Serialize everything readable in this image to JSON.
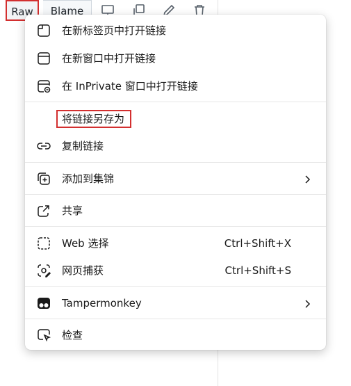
{
  "toolbar": {
    "raw_label": "Raw",
    "blame_label": "Blame",
    "icons": [
      "display-icon",
      "copy-icon",
      "pencil-icon",
      "trash-icon"
    ]
  },
  "menu": {
    "open_new_tab": "在新标签页中打开链接",
    "open_new_window": "在新窗口中打开链接",
    "open_inprivate": "在 InPrivate 窗口中打开链接",
    "save_link_as": "将链接另存为",
    "copy_link": "复制链接",
    "add_to_collections": "添加到集锦",
    "share": "共享",
    "web_select": "Web 选择",
    "web_select_shortcut": "Ctrl+Shift+X",
    "web_capture": "网页捕获",
    "web_capture_shortcut": "Ctrl+Shift+S",
    "tampermonkey": "Tampermonkey",
    "inspect": "检查"
  },
  "colors": {
    "highlight_red": "#d32f2f",
    "menu_text": "#1a1a1a",
    "separator": "#e6e6e6"
  }
}
